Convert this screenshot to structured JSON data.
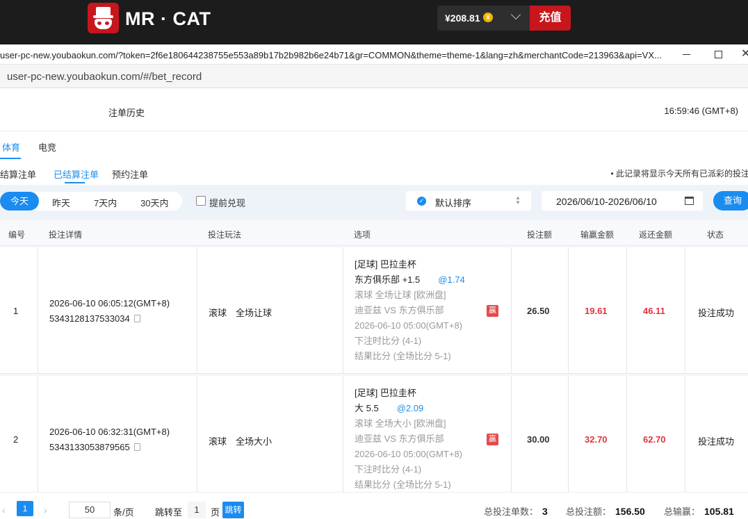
{
  "header": {
    "brand": "MR · CAT",
    "balance": "¥208.81",
    "coin_symbol": "¥",
    "recharge_label": "充值"
  },
  "window": {
    "title_url": "user-pc-new.youbaokun.com/?token=2f6e180644238755e553a89b17b2b982b6e24b71&gr=COMMON&theme=theme-1&lang=zh&merchantCode=213963&api=VX...",
    "close_glyph": "✕"
  },
  "address": {
    "url": "user-pc-new.youbaokun.com/#/bet_record"
  },
  "page": {
    "title": "注单历史",
    "clock": "16:59:46 (GMT+8)"
  },
  "sport_tabs": [
    "体育",
    "电竞"
  ],
  "status_tabs": [
    "未结算注单",
    "已结算注单",
    "预约注单"
  ],
  "notice": "• 此记录将显示今天所有已派彩的投注",
  "filters": {
    "days": [
      "今天",
      "昨天",
      "7天内",
      "30天内"
    ],
    "early_cashout_label": "提前兑现",
    "sort_label": "默认排序",
    "date_range": "2026/06/10-2026/06/10",
    "query_label": "查询"
  },
  "table": {
    "headers": [
      "编号",
      "投注详情",
      "投注玩法",
      "选项",
      "投注额",
      "输赢金额",
      "返还金额",
      "状态"
    ],
    "rows": [
      {
        "no": "1",
        "time": "2026-06-10 06:05:12(GMT+8)",
        "order_id": "5343128137533034",
        "play": "滚球　全场让球",
        "sel_league": "[足球] 巴拉圭杯",
        "sel_pick": "东方俱乐部 +1.5",
        "sel_odds": "@1.74",
        "sel_market": "滚球 全场让球 [欧洲盘]",
        "sel_match": "迪亚兹 VS 东方俱乐部",
        "sel_kickoff": "2026-06-10 05:00(GMT+8)",
        "sel_bet_score": "下注时比分 (4-1)",
        "sel_result": "结果比分 (全场比分 5-1)",
        "win_badge": "赢",
        "stake": "26.50",
        "winloss": "19.61",
        "returned": "46.11",
        "status": "投注成功"
      },
      {
        "no": "2",
        "time": "2026-06-10 06:32:31(GMT+8)",
        "order_id": "5343133053879565",
        "play": "滚球　全场大小",
        "sel_league": "[足球] 巴拉圭杯",
        "sel_pick": "大 5.5",
        "sel_odds": "@2.09",
        "sel_market": "滚球 全场大小 [欧洲盘]",
        "sel_match": "迪亚兹 VS 东方俱乐部",
        "sel_kickoff": "2026-06-10 05:00(GMT+8)",
        "sel_bet_score": "下注时比分 (4-1)",
        "sel_result": "结果比分 (全场比分 5-1)",
        "win_badge": "赢",
        "stake": "30.00",
        "winloss": "32.70",
        "returned": "62.70",
        "status": "投注成功"
      }
    ]
  },
  "pager": {
    "current_page": "1",
    "page_size": "50",
    "per_page_label": "条/页",
    "jump_label": "跳转至",
    "jump_value": "1",
    "page_label": "页",
    "go_label": "跳转",
    "total_count_label": "总投注单数：",
    "total_count": "3",
    "total_stake_label": "总投注额：",
    "total_stake": "156.50",
    "total_winloss_label": "总输赢：",
    "total_winloss": "105.81"
  }
}
